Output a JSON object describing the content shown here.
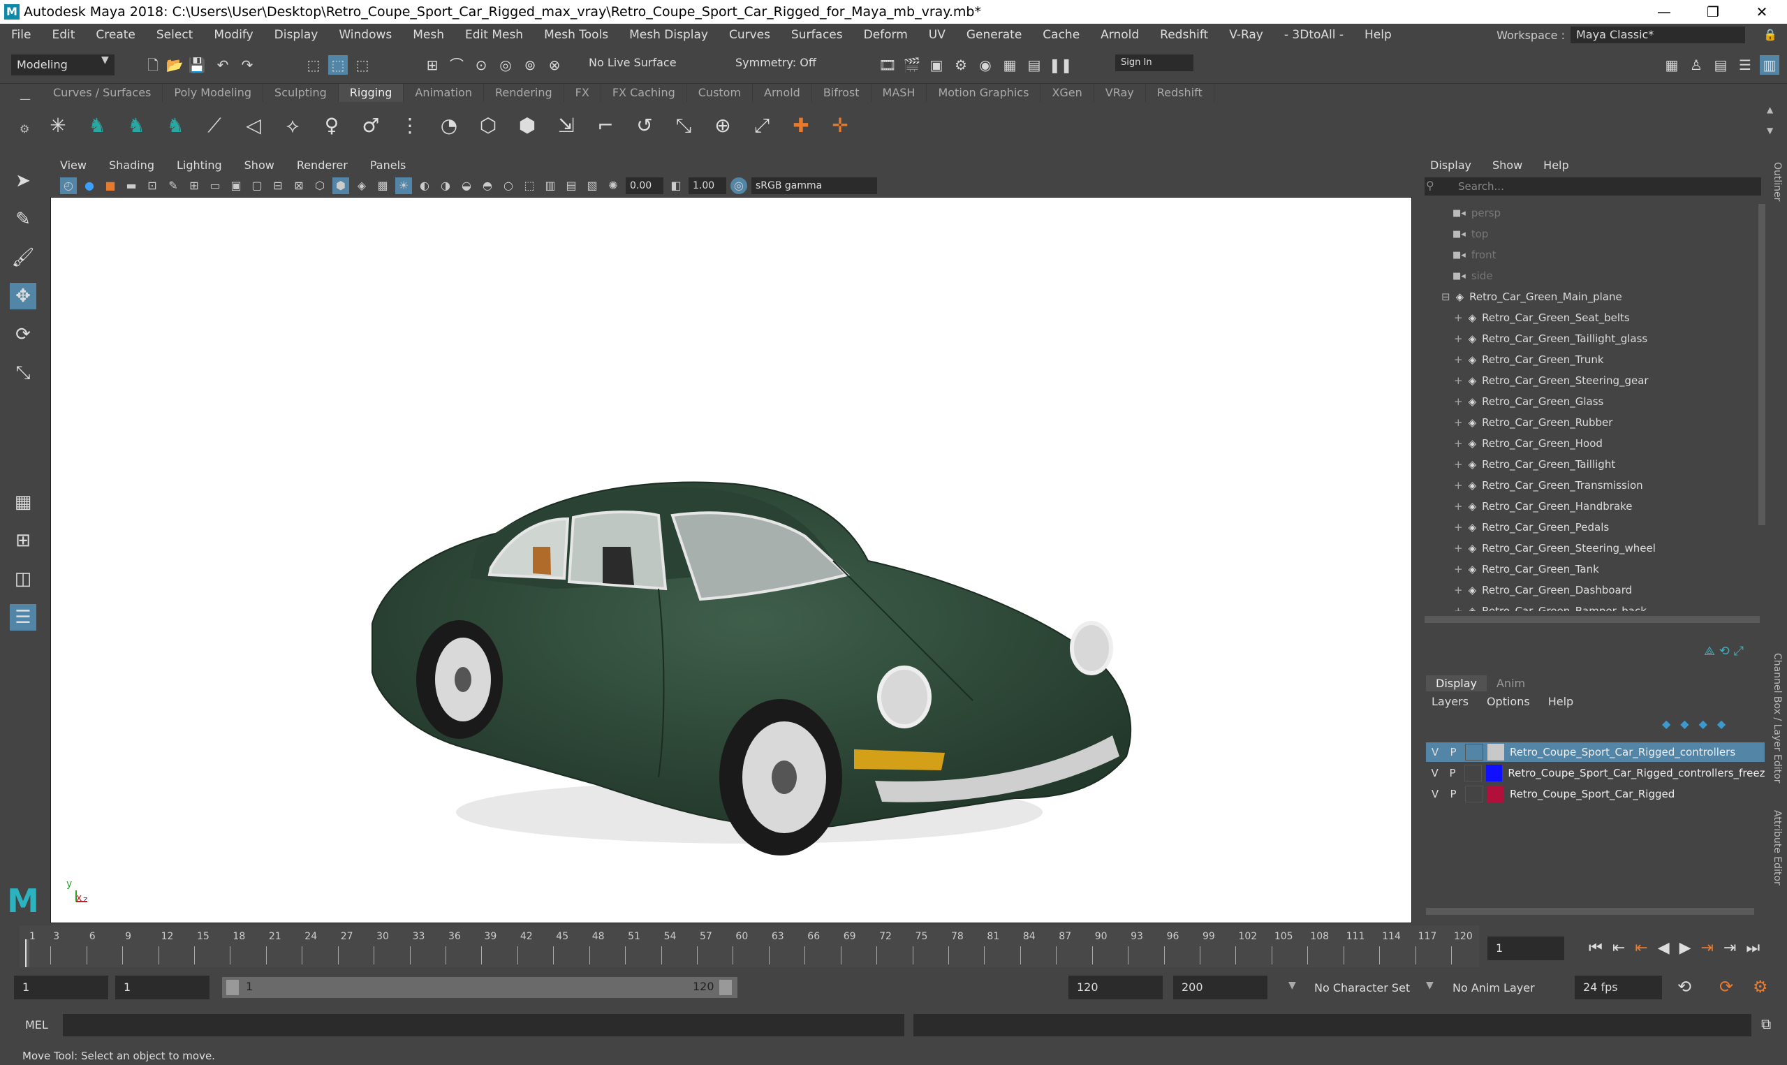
{
  "window": {
    "title": "Autodesk Maya 2018: C:\\Users\\User\\Desktop\\Retro_Coupe_Sport_Car_Rigged_max_vray\\Retro_Coupe_Sport_Car_Rigged_for_Maya_mb_vray.mb*",
    "logo": "M",
    "minimize": "—",
    "restore": "❐",
    "close": "✕"
  },
  "menubar": {
    "items": [
      "File",
      "Edit",
      "Create",
      "Select",
      "Modify",
      "Display",
      "Windows",
      "Mesh",
      "Edit Mesh",
      "Mesh Tools",
      "Mesh Display",
      "Curves",
      "Surfaces",
      "Deform",
      "UV",
      "Generate",
      "Cache",
      "Arnold",
      "Redshift",
      "V-Ray",
      "- 3DtoAll -",
      "Help"
    ],
    "workspace_label": "Workspace :",
    "workspace_value": "Maya Classic*"
  },
  "statusline": {
    "mode": "Modeling",
    "live_surface": "No Live Surface",
    "symmetry": "Symmetry: Off",
    "sign_in": "Sign In"
  },
  "shelf": {
    "tabs": [
      "Curves / Surfaces",
      "Poly Modeling",
      "Sculpting",
      "Rigging",
      "Animation",
      "Rendering",
      "FX",
      "FX Caching",
      "Custom",
      "Arnold",
      "Bifrost",
      "MASH",
      "Motion Graphics",
      "XGen",
      "VRay",
      "Redshift"
    ],
    "active_tab": "Rigging"
  },
  "viewport": {
    "menus": [
      "View",
      "Shading",
      "Lighting",
      "Show",
      "Renderer",
      "Panels"
    ],
    "exposure": "0.00",
    "gamma": "1.00",
    "color_space": "sRGB gamma",
    "axis_y": "y",
    "axis_x": "x",
    "axis_z": "z"
  },
  "outliner": {
    "menus": [
      "Display",
      "Show",
      "Help"
    ],
    "search_placeholder": "Search...",
    "side_tab": "Outliner",
    "cameras": [
      "persp",
      "top",
      "front",
      "side"
    ],
    "root": "Retro_Car_Green_Main_plane",
    "children": [
      "Retro_Car_Green_Seat_belts",
      "Retro_Car_Green_Taillight_glass",
      "Retro_Car_Green_Trunk",
      "Retro_Car_Green_Steering_gear",
      "Retro_Car_Green_Glass",
      "Retro_Car_Green_Rubber",
      "Retro_Car_Green_Hood",
      "Retro_Car_Green_Taillight",
      "Retro_Car_Green_Transmission",
      "Retro_Car_Green_Handbrake",
      "Retro_Car_Green_Pedals",
      "Retro_Car_Green_Steering_wheel",
      "Retro_Car_Green_Tank",
      "Retro_Car_Green_Dashboard",
      "Retro_Car_Green_Bamper_back"
    ]
  },
  "layers": {
    "tabs": [
      "Display",
      "Anim"
    ],
    "menus": [
      "Layers",
      "Options",
      "Help"
    ],
    "side_tab_1": "Channel Box / Layer Editor",
    "side_tab_2": "Attribute Editor",
    "rows": [
      {
        "v": "V",
        "p": "P",
        "color": "#c8c8c8",
        "name": "Retro_Coupe_Sport_Car_Rigged_controllers"
      },
      {
        "v": "V",
        "p": "P",
        "color": "#1010ff",
        "name": "Retro_Coupe_Sport_Car_Rigged_controllers_freeze"
      },
      {
        "v": "V",
        "p": "P",
        "color": "#b0103a",
        "name": "Retro_Coupe_Sport_Car_Rigged"
      }
    ]
  },
  "timeline": {
    "ticks": [
      "1",
      "3",
      "6",
      "9",
      "12",
      "15",
      "18",
      "21",
      "24",
      "27",
      "30",
      "33",
      "36",
      "39",
      "42",
      "45",
      "48",
      "51",
      "54",
      "57",
      "60",
      "63",
      "66",
      "69",
      "72",
      "75",
      "78",
      "81",
      "84",
      "87",
      "90",
      "93",
      "96",
      "99",
      "102",
      "105",
      "108",
      "111",
      "114",
      "117",
      "120"
    ],
    "current_frame": "1"
  },
  "range": {
    "start": "1",
    "playback_start": "1",
    "slider_start": "1",
    "slider_end": "120",
    "playback_end": "120",
    "end": "200",
    "character_set": "No Character Set",
    "anim_layer": "No Anim Layer",
    "fps": "24 fps"
  },
  "mel": {
    "label": "MEL"
  },
  "helpline": {
    "text": "Move Tool: Select an object to move."
  },
  "colors": {
    "car_body": "#2f4a3a",
    "selection": "#5285a6",
    "panel": "#444444",
    "field": "#2b2b2b"
  }
}
